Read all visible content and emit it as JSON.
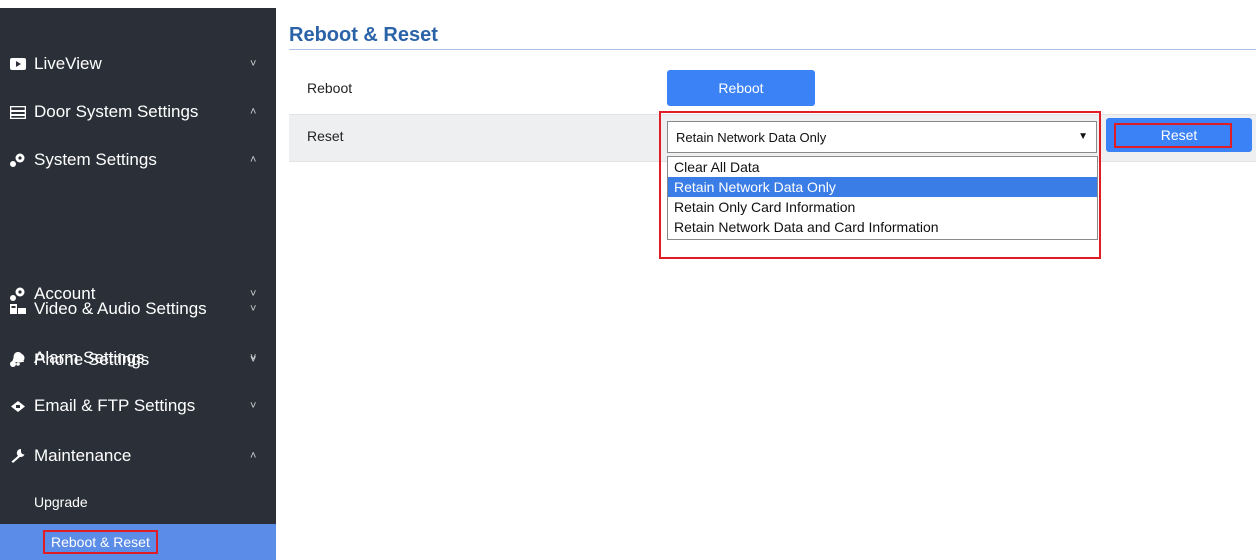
{
  "sidebar": {
    "items": [
      {
        "label": "LiveView",
        "icon": "video-icon",
        "chevron": "˅"
      },
      {
        "label": "Door System Settings",
        "icon": "door-panel-icon",
        "chevron": "˄"
      },
      {
        "label": "System Settings",
        "icon": "settings-icon",
        "chevron": "˄"
      },
      {
        "label": "Account",
        "icon": "account-icon",
        "chevron": "˅"
      },
      {
        "label": "Phone Settings",
        "icon": "phone-settings-icon",
        "chevron": "˅"
      },
      {
        "label": "Video & Audio Settings",
        "icon": "video-audio-icon",
        "chevron": "˅"
      },
      {
        "label": "Alarm Settings",
        "icon": "bell-icon",
        "chevron": "˅"
      },
      {
        "label": "Email & FTP Settings",
        "icon": "cloud-icon",
        "chevron": "˅"
      },
      {
        "label": "Maintenance",
        "icon": "wrench-icon",
        "chevron": "˄"
      }
    ],
    "subitems": [
      {
        "label": "Upgrade"
      },
      {
        "label": "Reboot & Reset"
      }
    ]
  },
  "main": {
    "title": "Reboot & Reset",
    "reboot": {
      "label": "Reboot",
      "button": "Reboot"
    },
    "reset": {
      "label": "Reset",
      "selected": "Retain Network Data Only",
      "button": "Reset",
      "options": [
        "Clear All Data",
        "Retain Network Data Only",
        "Retain Only Card Information",
        "Retain Network Data and Card Information"
      ],
      "selected_index": 1
    }
  },
  "colors": {
    "sidebar_bg": "#2b3038",
    "accent": "#3b82f6",
    "highlight": "#e01c24",
    "title": "#2b63a9"
  }
}
